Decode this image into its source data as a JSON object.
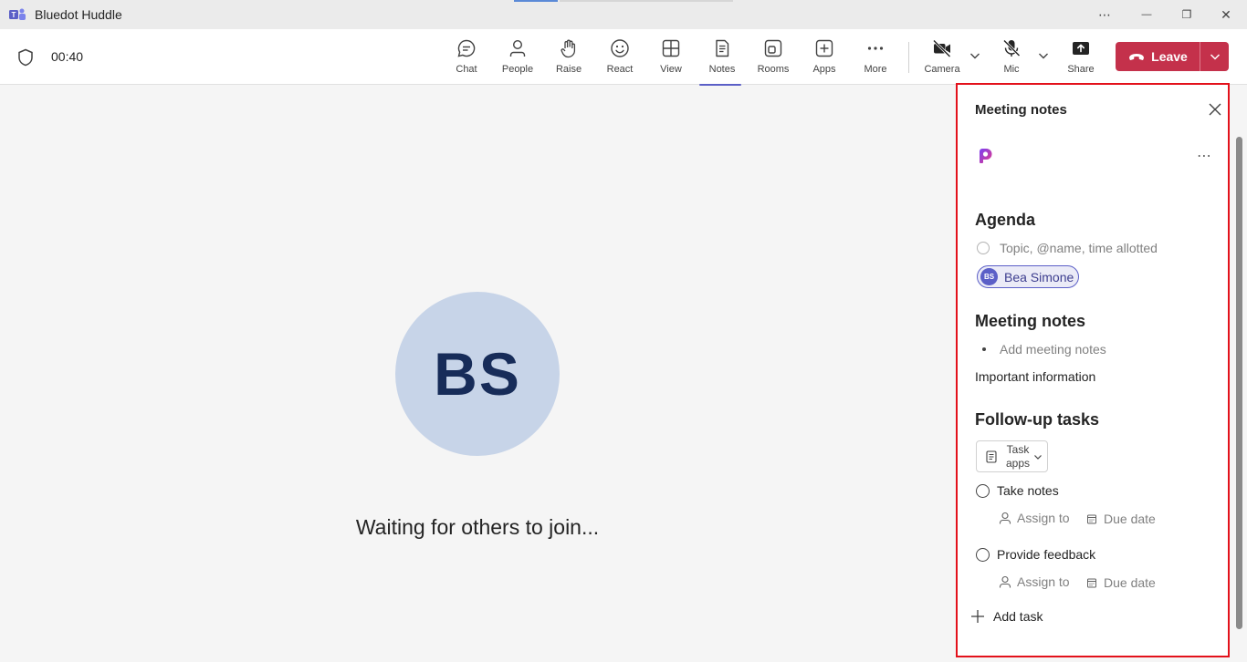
{
  "app": {
    "title": "Bluedot Huddle"
  },
  "window_controls": {
    "more": "⋯",
    "minimize": "—",
    "restore": "❐",
    "close": "✕"
  },
  "toolbar": {
    "timer": "00:40",
    "buttons": [
      {
        "label": "Chat",
        "icon": "chat-icon"
      },
      {
        "label": "People",
        "icon": "people-icon"
      },
      {
        "label": "Raise",
        "icon": "raise-hand-icon"
      },
      {
        "label": "React",
        "icon": "smile-icon"
      },
      {
        "label": "View",
        "icon": "grid-icon"
      },
      {
        "label": "Notes",
        "icon": "notes-icon",
        "active": true
      },
      {
        "label": "Rooms",
        "icon": "rooms-icon"
      },
      {
        "label": "Apps",
        "icon": "plus-square-icon"
      },
      {
        "label": "More",
        "icon": "more-icon"
      },
      {
        "label": "Camera",
        "icon": "camera-off-icon"
      },
      {
        "label": "Mic",
        "icon": "mic-off-icon"
      },
      {
        "label": "Share",
        "icon": "share-icon"
      }
    ],
    "leave_label": "Leave",
    "leave_color": "#c4314b"
  },
  "stage": {
    "avatar_initials": "BS",
    "waiting_text": "Waiting for others to join..."
  },
  "notes_panel": {
    "title": "Meeting notes",
    "agenda": {
      "heading": "Agenda",
      "placeholder": "Topic, @name, time allotted",
      "mention_initials": "BS",
      "mention_name": "Bea Simone"
    },
    "meeting_notes": {
      "heading": "Meeting notes",
      "placeholder": "Add meeting notes",
      "important": "Important information"
    },
    "follow_up": {
      "heading": "Follow-up tasks",
      "task_apps_line1": "Task",
      "task_apps_line2": "apps",
      "tasks": [
        {
          "title": "Take notes",
          "assign": "Assign to",
          "due": "Due date"
        },
        {
          "title": "Provide feedback",
          "assign": "Assign to",
          "due": "Due date"
        }
      ],
      "add_task": "Add task"
    }
  }
}
